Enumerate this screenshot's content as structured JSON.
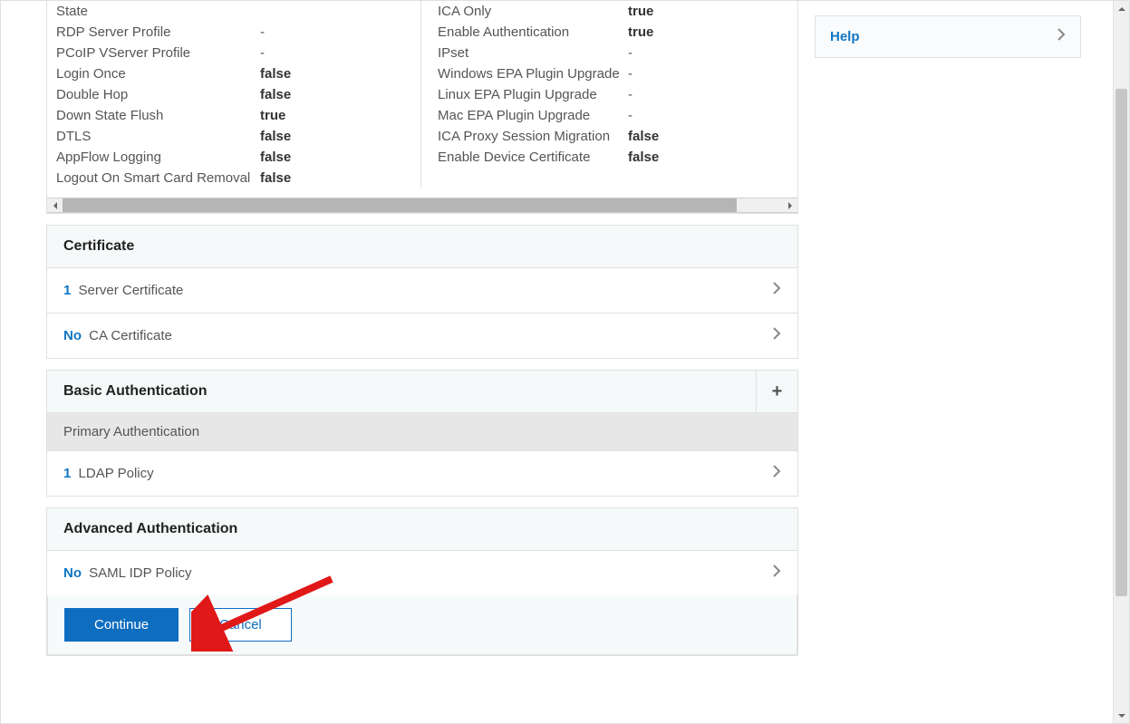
{
  "help": {
    "label": "Help"
  },
  "details": {
    "left": [
      {
        "k": "State",
        "v": ""
      },
      {
        "k": "RDP Server Profile",
        "v": "-"
      },
      {
        "k": "PCoIP VServer Profile",
        "v": "-"
      },
      {
        "k": "Login Once",
        "v": "false",
        "bold": true
      },
      {
        "k": "Double Hop",
        "v": "false",
        "bold": true
      },
      {
        "k": "Down State Flush",
        "v": "true",
        "bold": true
      },
      {
        "k": "DTLS",
        "v": "false",
        "bold": true
      },
      {
        "k": "AppFlow Logging",
        "v": "false",
        "bold": true
      },
      {
        "k": "Logout On Smart Card Removal",
        "v": "false",
        "bold": true
      }
    ],
    "right": [
      {
        "k": "ICA Only",
        "v": "true",
        "bold": true
      },
      {
        "k": "Enable Authentication",
        "v": "true",
        "bold": true
      },
      {
        "k": "IPset",
        "v": "-"
      },
      {
        "k": "Windows EPA Plugin Upgrade",
        "v": "-"
      },
      {
        "k": "Linux EPA Plugin Upgrade",
        "v": "-"
      },
      {
        "k": "Mac EPA Plugin Upgrade",
        "v": "-"
      },
      {
        "k": "ICA Proxy Session Migration",
        "v": "false",
        "bold": true
      },
      {
        "k": "Enable Device Certificate",
        "v": "false",
        "bold": true
      }
    ]
  },
  "panels": {
    "certificate": {
      "title": "Certificate",
      "rows": [
        {
          "count": "1",
          "label": "Server Certificate"
        },
        {
          "count": "No",
          "label": "CA Certificate"
        }
      ]
    },
    "basic_auth": {
      "title": "Basic Authentication",
      "subheader": "Primary Authentication",
      "rows": [
        {
          "count": "1",
          "label": "LDAP Policy"
        }
      ]
    },
    "advanced_auth": {
      "title": "Advanced Authentication",
      "rows": [
        {
          "count": "No",
          "label": "SAML IDP Policy"
        }
      ]
    }
  },
  "actions": {
    "continue": "Continue",
    "cancel": "Cancel"
  }
}
